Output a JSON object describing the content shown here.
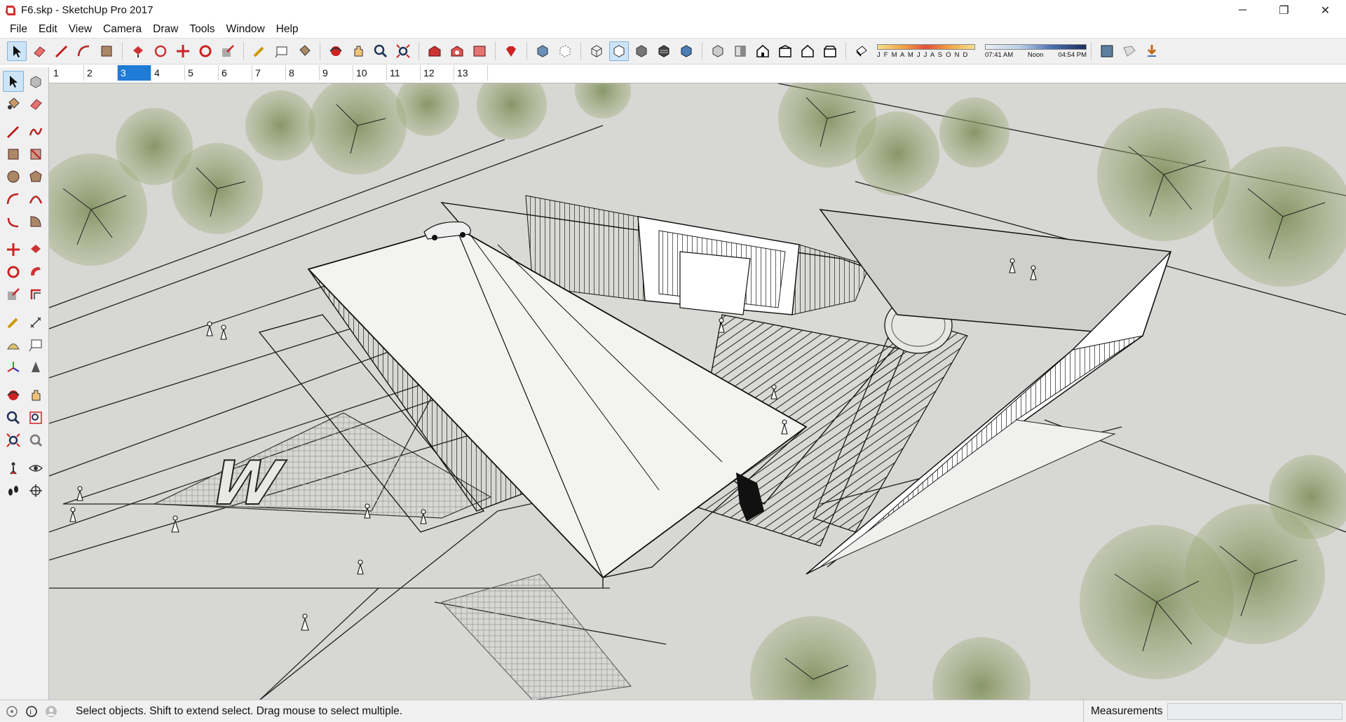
{
  "window": {
    "title": "F6.skp - SketchUp Pro 2017",
    "controls": {
      "minimize": "─",
      "maximize": "❐",
      "close": "✕"
    }
  },
  "menu": [
    "File",
    "Edit",
    "View",
    "Camera",
    "Draw",
    "Tools",
    "Window",
    "Help"
  ],
  "toolbar": {
    "icons": [
      "select-icon",
      "eraser-icon",
      "line-icon",
      "arc-icon",
      "shape-icon",
      "push-pull-icon",
      "offset-icon",
      "move-icon",
      "rotate-icon",
      "scale-icon",
      "tape-measure-icon",
      "text-icon",
      "paint-bucket-icon",
      "orbit-icon",
      "pan-icon",
      "zoom-icon",
      "zoom-extents-icon",
      "warehouse-icon",
      "extension-warehouse-icon",
      "layout-icon",
      "ruby-icon",
      "xray-icon",
      "back-edges-icon",
      "wireframe-icon",
      "hidden-line-icon",
      "shaded-icon",
      "shaded-textures-icon",
      "monochrome-icon",
      "iso-view-icon",
      "top-view-icon",
      "front-view-icon",
      "right-view-icon",
      "back-view-icon",
      "left-view-icon",
      "shadows-toggle-icon",
      "section-plane-icon",
      "display-section-icon",
      "add-location-icon"
    ],
    "shadow_months": "J F M A M J J A S O N D",
    "shadow_time_start": "07:41 AM",
    "shadow_time_noon": "Noon",
    "shadow_time_end": "04:54 PM",
    "accent": "#c0392b"
  },
  "scenes": [
    "1",
    "2",
    "3",
    "4",
    "5",
    "6",
    "7",
    "8",
    "9",
    "10",
    "11",
    "12",
    "13"
  ],
  "active_scene": "3",
  "palette": {
    "icons": [
      "select-icon",
      "make-component-icon",
      "paint-bucket-icon",
      "eraser-icon",
      "line-icon",
      "freehand-icon",
      "rectangle-icon",
      "rotated-rectangle-icon",
      "circle-icon",
      "polygon-icon",
      "arc-icon",
      "2-point-arc-icon",
      "3-point-arc-icon",
      "pie-icon",
      "move-icon",
      "push-pull-icon",
      "rotate-icon",
      "follow-me-icon",
      "scale-icon",
      "offset-icon",
      "tape-measure-icon",
      "dimension-icon",
      "protractor-icon",
      "text-icon",
      "axes-icon",
      "3d-text-icon",
      "orbit-icon",
      "pan-icon",
      "zoom-icon",
      "zoom-window-icon",
      "zoom-extents-icon",
      "previous-view-icon",
      "position-camera-icon",
      "look-around-icon",
      "walk-icon",
      "section-plane-icon"
    ]
  },
  "viewport": {
    "text_on_ground": "W"
  },
  "status": {
    "message": "Select objects. Shift to extend select. Drag mouse to select multiple.",
    "measurements_label": "Measurements",
    "measurements_value": ""
  }
}
